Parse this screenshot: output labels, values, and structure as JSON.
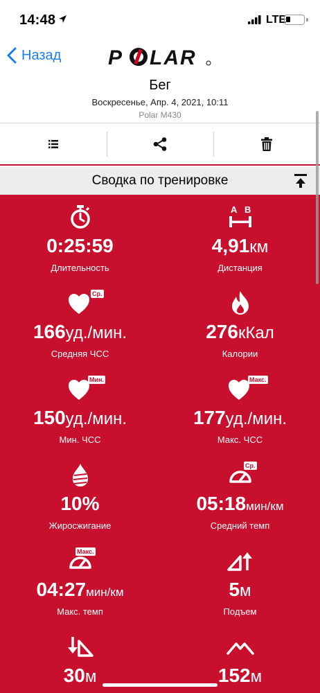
{
  "status": {
    "time": "14:48",
    "network": "LTE"
  },
  "nav": {
    "back_label": "Назад",
    "logo_text": "POLAR"
  },
  "header": {
    "title": "Бег",
    "datetime": "Воскресенье, Апр. 4, 2021, 10:11",
    "device": "Polar M430"
  },
  "toolbar": {
    "icons": [
      "list-icon",
      "share-icon",
      "trash-icon"
    ]
  },
  "summary": {
    "title": "Сводка по тренировке"
  },
  "colors": {
    "accent": "#c8102e",
    "link": "#1a7cf5",
    "header_bg": "#ececec"
  },
  "metrics": [
    {
      "icon": "stopwatch-icon",
      "value": "0:25:59",
      "unit": "",
      "label": "Длительность"
    },
    {
      "icon": "distance-ab-icon",
      "value": "4,91",
      "unit": "км",
      "label": "Дистанция",
      "icon_text_a": "A",
      "icon_text_b": "B"
    },
    {
      "icon": "heart-avg-icon",
      "tag": "Ср.",
      "value": "166",
      "unit": "уд./мин.",
      "label": "Средняя ЧСС"
    },
    {
      "icon": "flame-icon",
      "value": "276",
      "unit": "кКал",
      "label": "Калории"
    },
    {
      "icon": "heart-min-icon",
      "tag": "Мин.",
      "value": "150",
      "unit": "уд./мин.",
      "label": "Мин. ЧСС"
    },
    {
      "icon": "heart-max-icon",
      "tag": "Макс.",
      "value": "177",
      "unit": "уд./мин.",
      "label": "Макс. ЧСС"
    },
    {
      "icon": "fat-burn-icon",
      "value": "10%",
      "unit": "",
      "label": "Жиросжигание"
    },
    {
      "icon": "speedometer-avg-icon",
      "tag": "Ср.",
      "value": "05:18",
      "unit": "мин/км",
      "label": "Средний темп"
    },
    {
      "icon": "speedometer-max-icon",
      "tag": "Макс.",
      "value": "04:27",
      "unit": "мин/км",
      "label": "Макс. темп"
    },
    {
      "icon": "ascent-icon",
      "value": "5",
      "unit": "м",
      "label": "Подъем"
    },
    {
      "icon": "descent-icon",
      "value": "30",
      "unit": "м",
      "label": ""
    },
    {
      "icon": "mountain-icon",
      "value": "152",
      "unit": "м",
      "label": ""
    }
  ]
}
